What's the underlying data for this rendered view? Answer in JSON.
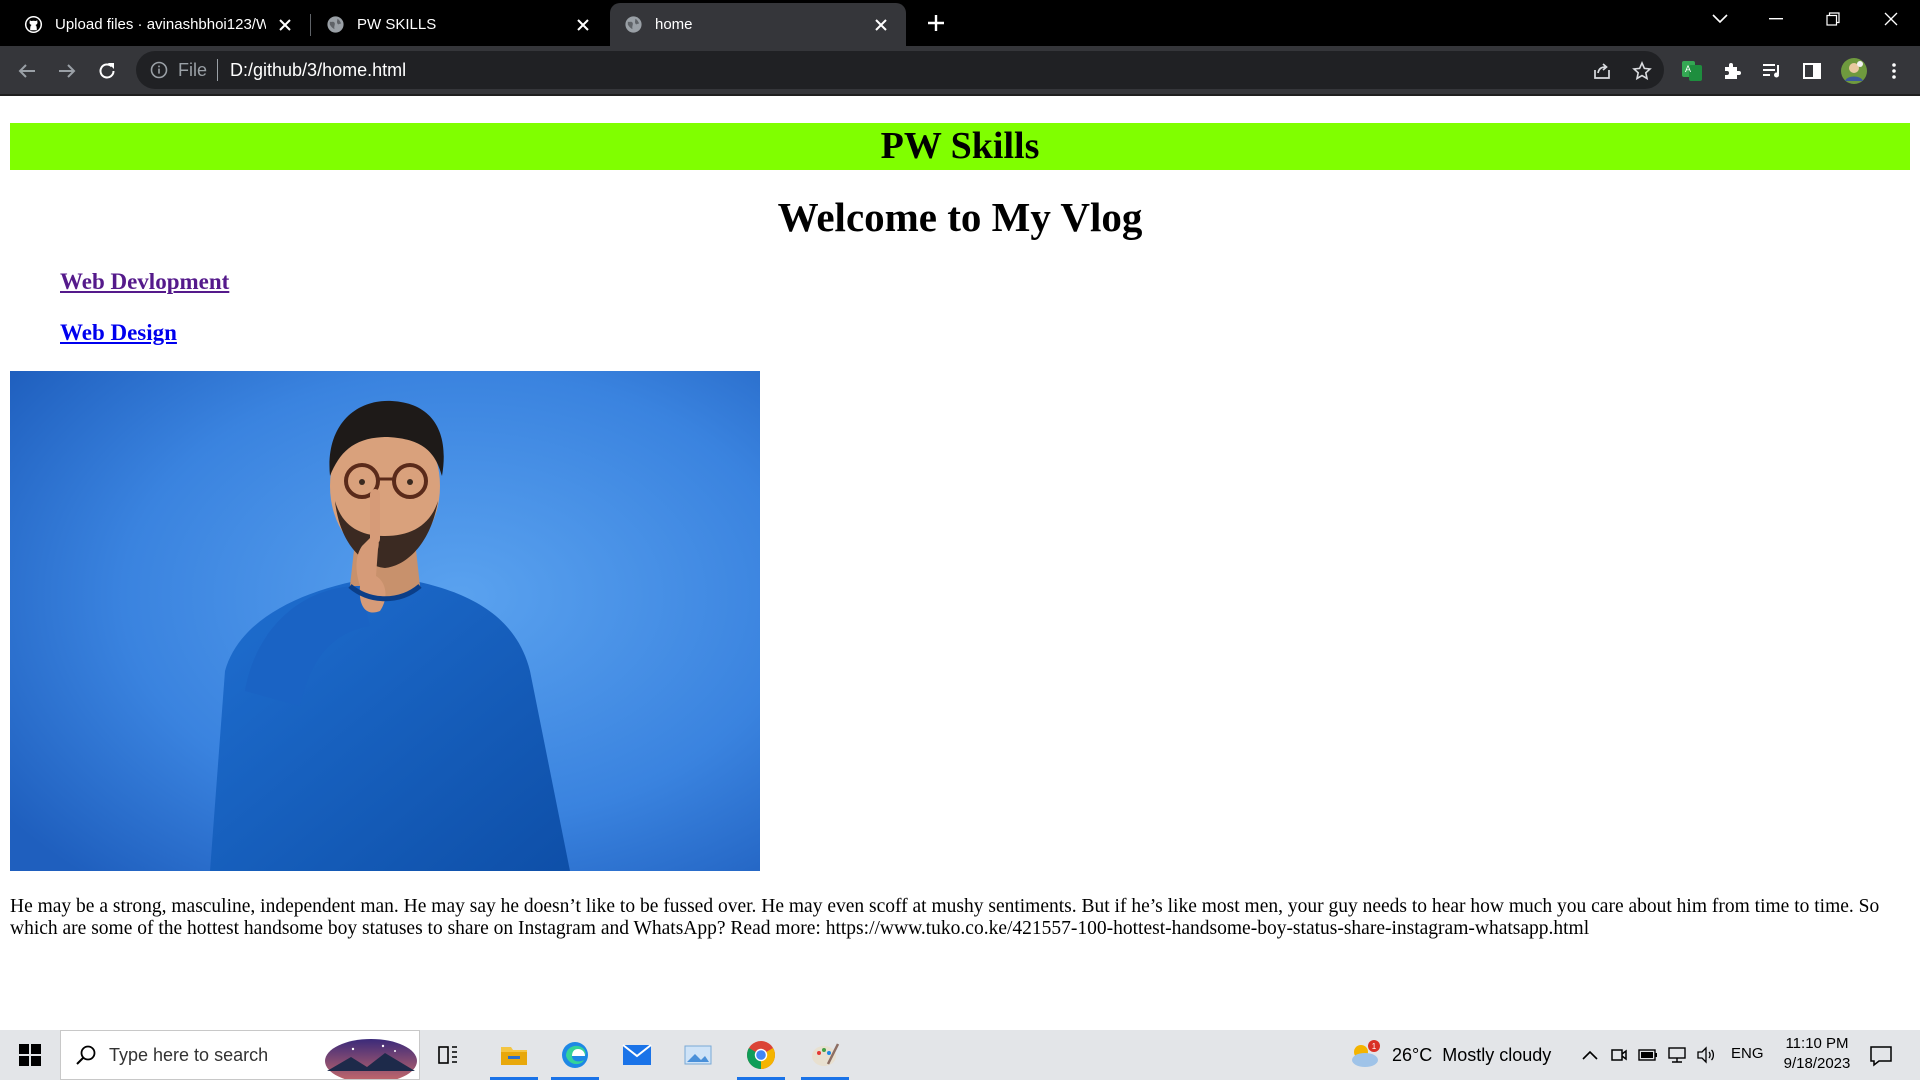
{
  "browser": {
    "tabs": [
      {
        "title": "Upload files · avinashbhoi123/We",
        "icon": "github-icon",
        "active": false
      },
      {
        "title": "PW SKILLS",
        "icon": "globe-icon",
        "active": false
      },
      {
        "title": "home",
        "icon": "globe-icon",
        "active": true
      }
    ],
    "address": {
      "scheme": "File",
      "url": "D:/github/3/home.html"
    }
  },
  "page": {
    "header_title": "PW Skills",
    "welcome_heading": "Welcome to My Vlog",
    "links": [
      {
        "label": "Web Devlopment",
        "visited": true
      },
      {
        "label": "Web Design",
        "visited": false
      }
    ],
    "hero_image": "man-shush-gesture-photo",
    "paragraph": "He may be a strong, masculine, independent man. He may say he doesn’t like to be fussed over. He may even scoff at mushy sentiments. But if he’s like most men, your guy needs to hear how much you care about him from time to time. So which are some of the hottest handsome boy statuses to share on Instagram and WhatsApp? Read more: https://www.tuko.co.ke/421557-100-hottest-handsome-boy-status-share-instagram-whatsapp.html"
  },
  "taskbar": {
    "search_placeholder": "Type here to search",
    "weather": {
      "temperature": "26°C",
      "condition": "Mostly cloudy",
      "badge": "1"
    },
    "language": "ENG",
    "time": "11:10 PM",
    "date": "9/18/2023"
  },
  "colors": {
    "header_bg": "#80ff00",
    "visited_link": "#551a8b",
    "link": "#0000ee",
    "tabbar_bg": "#000000",
    "toolbar_bg": "#35363a"
  }
}
